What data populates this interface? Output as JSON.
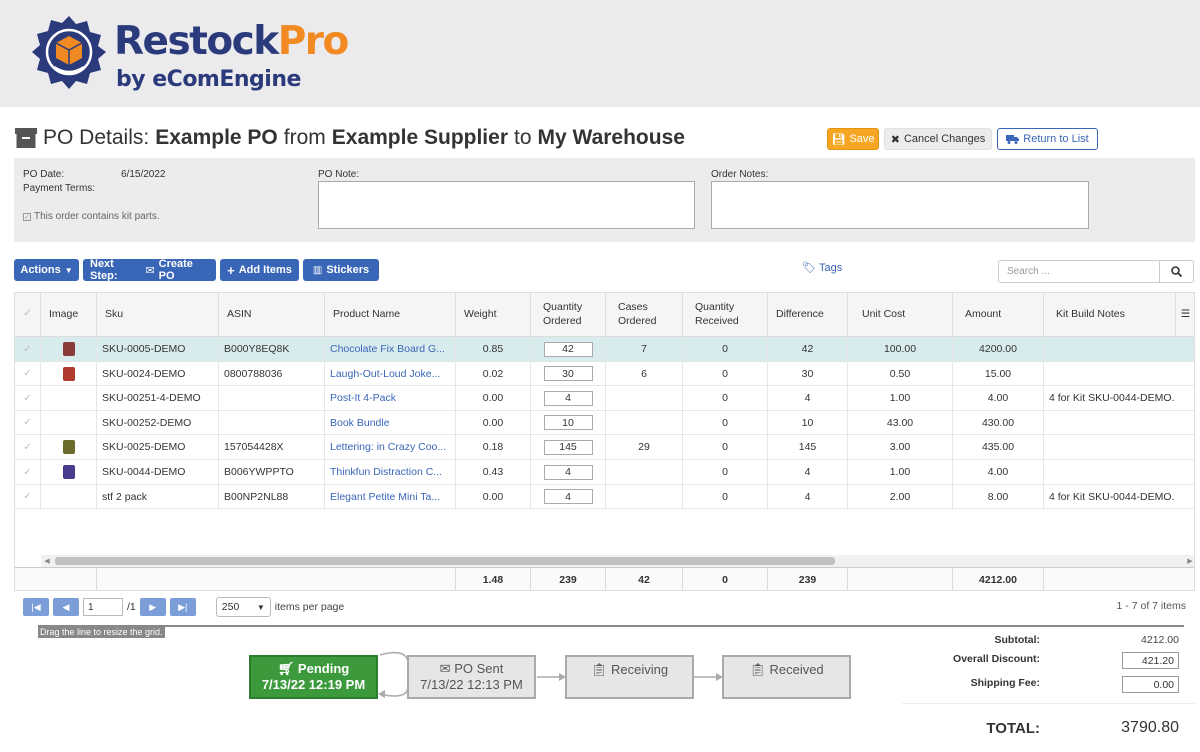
{
  "brand": {
    "name_part1": "Restock",
    "name_part2": "Pro",
    "tagline": "by eComEngine",
    "accent": "#f28a24",
    "primary": "#2b3a7a"
  },
  "title": {
    "prefix": "PO Details:",
    "po_name": "Example PO",
    "from": "from",
    "supplier": "Example Supplier",
    "to": "to",
    "destination": "My Warehouse"
  },
  "actions": {
    "save": "Save",
    "cancel": "Cancel Changes",
    "return": "Return to List"
  },
  "info": {
    "po_date_label": "PO Date:",
    "po_date": "6/15/2022",
    "payment_terms_label": "Payment Terms:",
    "kit_parts": "This order contains kit parts.",
    "po_note_label": "PO Note:",
    "order_notes_label": "Order Notes:"
  },
  "toolbar": {
    "actions": "Actions",
    "next_step": "Next Step:",
    "create_po": "Create PO",
    "add_items": "Add Items",
    "stickers": "Stickers",
    "tags": "Tags",
    "search_placeholder": "Search ..."
  },
  "grid": {
    "columns": [
      "Image",
      "Sku",
      "ASIN",
      "Product Name",
      "Weight",
      "Quantity Ordered",
      "Cases Ordered",
      "Quantity Received",
      "Difference",
      "Unit Cost",
      "Amount",
      "Kit Build Notes"
    ],
    "rows": [
      {
        "sku": "SKU-0005-DEMO",
        "asin": "B000Y8EQ8K",
        "name": "Chocolate Fix Board G...",
        "weight": "0.85",
        "qty": "42",
        "cases": "7",
        "received": "0",
        "diff": "42",
        "cost": "100.00",
        "amount": "4200.00",
        "kit": ""
      },
      {
        "sku": "SKU-0024-DEMO",
        "asin": "0800788036",
        "name": "Laugh-Out-Loud Joke...",
        "weight": "0.02",
        "qty": "30",
        "cases": "6",
        "received": "0",
        "diff": "30",
        "cost": "0.50",
        "amount": "15.00",
        "kit": ""
      },
      {
        "sku": "SKU-00251-4-DEMO",
        "asin": "",
        "name": "Post-It 4-Pack",
        "weight": "0.00",
        "qty": "4",
        "cases": "",
        "received": "0",
        "diff": "4",
        "cost": "1.00",
        "amount": "4.00",
        "kit": "4 for Kit SKU-0044-DEMO."
      },
      {
        "sku": "SKU-00252-DEMO",
        "asin": "",
        "name": "Book Bundle",
        "weight": "0.00",
        "qty": "10",
        "cases": "",
        "received": "0",
        "diff": "10",
        "cost": "43.00",
        "amount": "430.00",
        "kit": ""
      },
      {
        "sku": "SKU-0025-DEMO",
        "asin": "157054428X",
        "name": "Lettering: in Crazy Coo...",
        "weight": "0.18",
        "qty": "145",
        "cases": "29",
        "received": "0",
        "diff": "145",
        "cost": "3.00",
        "amount": "435.00",
        "kit": ""
      },
      {
        "sku": "SKU-0044-DEMO",
        "asin": "B006YWPPTO",
        "name": "Thinkfun Distraction C...",
        "weight": "0.43",
        "qty": "4",
        "cases": "",
        "received": "0",
        "diff": "4",
        "cost": "1.00",
        "amount": "4.00",
        "kit": ""
      },
      {
        "sku": "stf 2 pack",
        "asin": "B00NP2NL88",
        "name": "Elegant Petite Mini Ta...",
        "weight": "0.00",
        "qty": "4",
        "cases": "",
        "received": "0",
        "diff": "4",
        "cost": "2.00",
        "amount": "8.00",
        "kit": "4 for Kit SKU-0044-DEMO."
      }
    ],
    "footer": {
      "weight": "1.48",
      "qty": "239",
      "cases": "42",
      "received": "0",
      "diff": "239",
      "amount": "4212.00"
    }
  },
  "pager": {
    "page": "1",
    "of": "/1",
    "per_page": "250",
    "items_per_page": "items per page",
    "range": "1 - 7 of 7 items",
    "drag_hint": "Drag the line to resize the grid."
  },
  "workflow": [
    {
      "label": "Pending",
      "date": "7/13/22 12:19 PM"
    },
    {
      "label": "PO Sent",
      "date": "7/13/22 12:13 PM"
    },
    {
      "label": "Receiving",
      "date": ""
    },
    {
      "label": "Received",
      "date": ""
    }
  ],
  "totals": {
    "subtotal_label": "Subtotal:",
    "subtotal": "4212.00",
    "discount_label": "Overall Discount:",
    "discount": "421.20",
    "shipping_label": "Shipping Fee:",
    "shipping": "0.00",
    "total_label": "TOTAL:",
    "total": "3790.80"
  }
}
